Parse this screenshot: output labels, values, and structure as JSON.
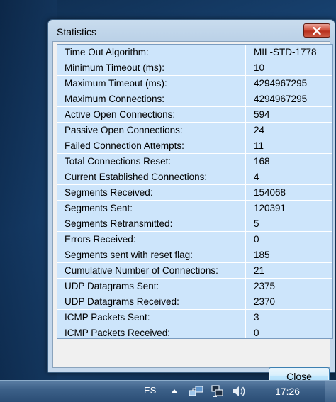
{
  "window": {
    "title": "Statistics",
    "close_button_label": "Close"
  },
  "stats": [
    {
      "name": "Time Out Algorithm:",
      "value": "MIL-STD-1778"
    },
    {
      "name": "Minimum Timeout (ms):",
      "value": "10"
    },
    {
      "name": "Maximum Timeout (ms):",
      "value": "4294967295"
    },
    {
      "name": "Maximum Connections:",
      "value": "4294967295"
    },
    {
      "name": "Active Open Connections:",
      "value": "594"
    },
    {
      "name": "Passive Open Connections:",
      "value": "24"
    },
    {
      "name": "Failed Connection Attempts:",
      "value": "11"
    },
    {
      "name": "Total Connections Reset:",
      "value": "168"
    },
    {
      "name": "Current Established Connections:",
      "value": "4"
    },
    {
      "name": "Segments Received:",
      "value": "154068"
    },
    {
      "name": "Segments Sent:",
      "value": "120391"
    },
    {
      "name": "Segments Retransmitted:",
      "value": "5"
    },
    {
      "name": "Errors Received:",
      "value": "0"
    },
    {
      "name": "Segments sent with reset flag:",
      "value": "185"
    },
    {
      "name": "Cumulative Number of Connections:",
      "value": "21"
    },
    {
      "name": "UDP Datagrams Sent:",
      "value": "2375"
    },
    {
      "name": "UDP Datagrams Received:",
      "value": "2370"
    },
    {
      "name": "ICMP Packets Sent:",
      "value": "3"
    },
    {
      "name": "ICMP Packets Received:",
      "value": "0"
    }
  ],
  "taskbar": {
    "language": "ES",
    "clock": "17:26",
    "tray_icons": [
      "show-hidden-icons-arrow-icon",
      "network-share-icon",
      "network-icon",
      "volume-icon"
    ]
  }
}
